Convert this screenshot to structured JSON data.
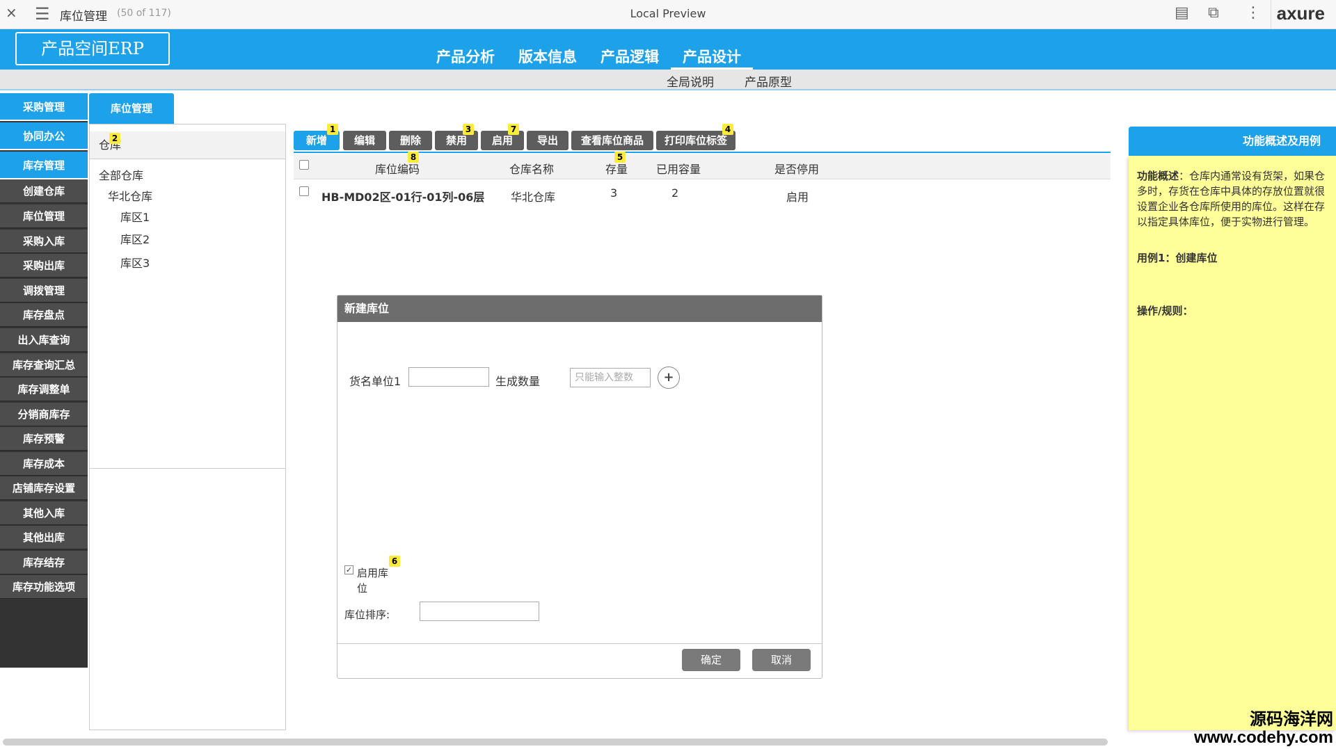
{
  "preview_bar": {
    "page_title": "库位管理",
    "page_count": "(50 of 117)",
    "window_title": "Local Preview",
    "brand": "axure",
    "close_glyph": "×",
    "menu_glyph": "☰",
    "notes_glyph": "▤",
    "share_glyph": "⧉",
    "more_glyph": "⋮"
  },
  "header": {
    "logo_text": "产品空间ERP",
    "nav": [
      "产品分析",
      "版本信息",
      "产品逻辑",
      "产品设计"
    ],
    "sub_nav": [
      "全局说明",
      "产品原型"
    ]
  },
  "sidebar": {
    "items": [
      "采购管理",
      "协同办公",
      "库存管理",
      "创建仓库",
      "库位管理",
      "采购入库",
      "采购出库",
      "调拨管理",
      "库存盘点",
      "出入库查询",
      "库存查询汇总",
      "库存调整单",
      "分销商库存",
      "库存预警",
      "库存成本",
      "店铺库存设置",
      "其他入库",
      "其他出库",
      "库存结存",
      "库存功能选项"
    ]
  },
  "tab": {
    "label": "库位管理"
  },
  "tree": {
    "header": "仓库",
    "badge": "2",
    "nodes": [
      "全部仓库",
      "华北仓库",
      "库区1",
      "库区2",
      "库区3"
    ]
  },
  "toolbar": {
    "buttons": [
      "新增",
      "编辑",
      "删除",
      "禁用",
      "启用",
      "导出",
      "查看库位商品",
      "打印库位标签"
    ],
    "badges": [
      "1",
      "3",
      "7",
      "4"
    ]
  },
  "table": {
    "headers": [
      "库位编码",
      "仓库名称",
      "存量",
      "已用容量",
      "是否停用"
    ],
    "header_badges": [
      "8",
      "5"
    ],
    "rows": [
      {
        "code": "HB-MD02区-01行-01列-06层",
        "warehouse": "华北仓库",
        "stock": "3",
        "used": "2",
        "status": "启用"
      }
    ]
  },
  "modal": {
    "title": "新建库位",
    "unit_label": "货名单位1",
    "unit_value": "",
    "qty_label": "生成数量",
    "qty_placeholder": "只能输入整数",
    "plus_glyph": "+",
    "enable_label_1": "启用库",
    "enable_label_2": "位",
    "enable_badge": "6",
    "enable_checked": "✓",
    "sort_label": "库位排序:",
    "sort_value": "",
    "confirm": "确定",
    "cancel": "取消"
  },
  "notes": {
    "header": "功能概述及用例",
    "desc_title": "功能概述",
    "desc_lines": [
      "：仓库内通常设有货架，如果仓",
      "多时，存货在仓库中具体的存放位置就很",
      "设置企业各仓库所使用的库位。这样在存",
      "以指定具体库位，便于实物进行管理。"
    ],
    "case": "用例1：创建库位",
    "rules": "操作/规则："
  },
  "watermark": {
    "line1": "源码海洋网",
    "line2": "www.codehy.com"
  },
  "colors": {
    "brand_blue": "#1da1e8",
    "sidebar_dark": "#4d4d4d",
    "note_yellow": "#ffff99",
    "badge_yellow": "#ffeb3b"
  }
}
